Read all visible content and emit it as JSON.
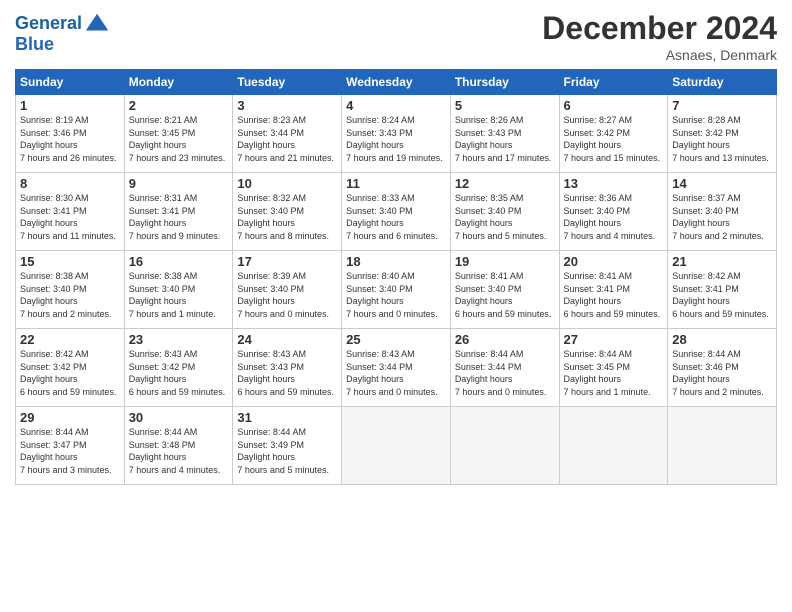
{
  "header": {
    "logo_line1": "General",
    "logo_line2": "Blue",
    "month": "December 2024",
    "location": "Asnaes, Denmark"
  },
  "weekdays": [
    "Sunday",
    "Monday",
    "Tuesday",
    "Wednesday",
    "Thursday",
    "Friday",
    "Saturday"
  ],
  "weeks": [
    [
      {
        "day": "1",
        "sunrise": "8:19 AM",
        "sunset": "3:46 PM",
        "daylight": "7 hours and 26 minutes."
      },
      {
        "day": "2",
        "sunrise": "8:21 AM",
        "sunset": "3:45 PM",
        "daylight": "7 hours and 23 minutes."
      },
      {
        "day": "3",
        "sunrise": "8:23 AM",
        "sunset": "3:44 PM",
        "daylight": "7 hours and 21 minutes."
      },
      {
        "day": "4",
        "sunrise": "8:24 AM",
        "sunset": "3:43 PM",
        "daylight": "7 hours and 19 minutes."
      },
      {
        "day": "5",
        "sunrise": "8:26 AM",
        "sunset": "3:43 PM",
        "daylight": "7 hours and 17 minutes."
      },
      {
        "day": "6",
        "sunrise": "8:27 AM",
        "sunset": "3:42 PM",
        "daylight": "7 hours and 15 minutes."
      },
      {
        "day": "7",
        "sunrise": "8:28 AM",
        "sunset": "3:42 PM",
        "daylight": "7 hours and 13 minutes."
      }
    ],
    [
      {
        "day": "8",
        "sunrise": "8:30 AM",
        "sunset": "3:41 PM",
        "daylight": "7 hours and 11 minutes."
      },
      {
        "day": "9",
        "sunrise": "8:31 AM",
        "sunset": "3:41 PM",
        "daylight": "7 hours and 9 minutes."
      },
      {
        "day": "10",
        "sunrise": "8:32 AM",
        "sunset": "3:40 PM",
        "daylight": "7 hours and 8 minutes."
      },
      {
        "day": "11",
        "sunrise": "8:33 AM",
        "sunset": "3:40 PM",
        "daylight": "7 hours and 6 minutes."
      },
      {
        "day": "12",
        "sunrise": "8:35 AM",
        "sunset": "3:40 PM",
        "daylight": "7 hours and 5 minutes."
      },
      {
        "day": "13",
        "sunrise": "8:36 AM",
        "sunset": "3:40 PM",
        "daylight": "7 hours and 4 minutes."
      },
      {
        "day": "14",
        "sunrise": "8:37 AM",
        "sunset": "3:40 PM",
        "daylight": "7 hours and 2 minutes."
      }
    ],
    [
      {
        "day": "15",
        "sunrise": "8:38 AM",
        "sunset": "3:40 PM",
        "daylight": "7 hours and 2 minutes."
      },
      {
        "day": "16",
        "sunrise": "8:38 AM",
        "sunset": "3:40 PM",
        "daylight": "7 hours and 1 minute."
      },
      {
        "day": "17",
        "sunrise": "8:39 AM",
        "sunset": "3:40 PM",
        "daylight": "7 hours and 0 minutes."
      },
      {
        "day": "18",
        "sunrise": "8:40 AM",
        "sunset": "3:40 PM",
        "daylight": "7 hours and 0 minutes."
      },
      {
        "day": "19",
        "sunrise": "8:41 AM",
        "sunset": "3:40 PM",
        "daylight": "6 hours and 59 minutes."
      },
      {
        "day": "20",
        "sunrise": "8:41 AM",
        "sunset": "3:41 PM",
        "daylight": "6 hours and 59 minutes."
      },
      {
        "day": "21",
        "sunrise": "8:42 AM",
        "sunset": "3:41 PM",
        "daylight": "6 hours and 59 minutes."
      }
    ],
    [
      {
        "day": "22",
        "sunrise": "8:42 AM",
        "sunset": "3:42 PM",
        "daylight": "6 hours and 59 minutes."
      },
      {
        "day": "23",
        "sunrise": "8:43 AM",
        "sunset": "3:42 PM",
        "daylight": "6 hours and 59 minutes."
      },
      {
        "day": "24",
        "sunrise": "8:43 AM",
        "sunset": "3:43 PM",
        "daylight": "6 hours and 59 minutes."
      },
      {
        "day": "25",
        "sunrise": "8:43 AM",
        "sunset": "3:44 PM",
        "daylight": "7 hours and 0 minutes."
      },
      {
        "day": "26",
        "sunrise": "8:44 AM",
        "sunset": "3:44 PM",
        "daylight": "7 hours and 0 minutes."
      },
      {
        "day": "27",
        "sunrise": "8:44 AM",
        "sunset": "3:45 PM",
        "daylight": "7 hours and 1 minute."
      },
      {
        "day": "28",
        "sunrise": "8:44 AM",
        "sunset": "3:46 PM",
        "daylight": "7 hours and 2 minutes."
      }
    ],
    [
      {
        "day": "29",
        "sunrise": "8:44 AM",
        "sunset": "3:47 PM",
        "daylight": "7 hours and 3 minutes."
      },
      {
        "day": "30",
        "sunrise": "8:44 AM",
        "sunset": "3:48 PM",
        "daylight": "7 hours and 4 minutes."
      },
      {
        "day": "31",
        "sunrise": "8:44 AM",
        "sunset": "3:49 PM",
        "daylight": "7 hours and 5 minutes."
      },
      null,
      null,
      null,
      null
    ]
  ]
}
